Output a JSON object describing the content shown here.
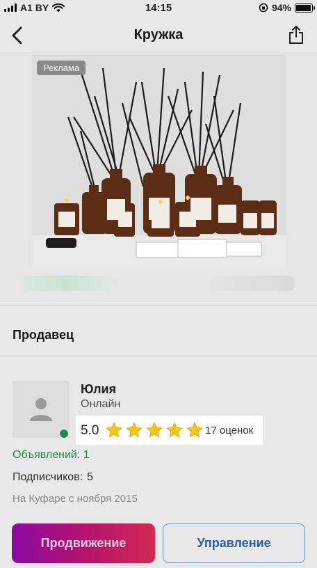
{
  "status_bar": {
    "carrier": "A1 BY",
    "time": "14:15",
    "battery": "94%",
    "battery_level": 0.94
  },
  "nav": {
    "title": "Кружка",
    "back_icon": "chevron-left-icon",
    "share_icon": "share-icon"
  },
  "ad": {
    "badge": "Реклама"
  },
  "seller": {
    "header": "Продавец",
    "name": "Юлия",
    "status": "Онлайн",
    "rating": "5.0",
    "stars": 5,
    "rating_count": "17 оценок",
    "listings": "Объявлений: 1",
    "subscribers_label": "Подписчиков:",
    "subscribers_value": "5",
    "member_since": "На Куфаре с ноября 2015",
    "online_color": "#1f8f4e",
    "star_color": "#f5c518"
  },
  "actions": {
    "promote_label": "Продвижение",
    "manage_label": "Управление"
  }
}
